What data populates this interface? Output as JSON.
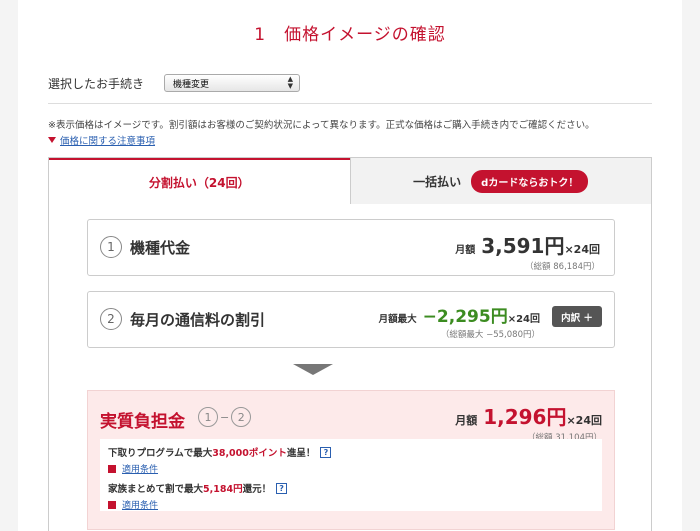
{
  "header": {
    "title": "1　価格イメージの確認"
  },
  "procedure": {
    "label": "選択したお手続き",
    "selected": "機種変更",
    "arrows_icon": "updown-arrows-icon"
  },
  "note": "※表示価格はイメージです。割引額はお客様のご契約状況によって異なります。正式な価格はご購入手続き内でご確認ください。",
  "notice_link": {
    "label": "価格に関する注意事項",
    "icon": "triangle-down-icon"
  },
  "tabs": [
    {
      "label": "分割払い（24回）",
      "active": true
    },
    {
      "label": "一括払い",
      "badge": "dカードならおトク！",
      "active": false
    }
  ],
  "items": [
    {
      "num": "1",
      "label": "機種代金",
      "prefix": "月額",
      "amount": "3,591円",
      "suffix": "×24回",
      "sub": "（総額 86,184円）"
    },
    {
      "num": "2",
      "label": "毎月の通信料の割引",
      "prefix": "月額最大",
      "amount": "−2,295円",
      "suffix": "×24回",
      "sub": "（総額最大 −55,080円）",
      "button": "内訳 ＋"
    }
  ],
  "total": {
    "label": "実質負担金",
    "formula": {
      "a": "1",
      "dash": "−",
      "b": "2"
    },
    "prefix": "月額",
    "amount": "1,296円",
    "suffix": "×24回",
    "sub": "（総額 31,104円）",
    "promos": [
      {
        "text_a": "下取りプログラムで最大",
        "highlight": "38,000ポイント",
        "text_b": "進呈！",
        "help": "?",
        "cond": "適用条件"
      },
      {
        "text_a": "家族まとめて割で最大",
        "highlight": "5,184円",
        "text_b": "還元！",
        "help": "?",
        "cond": "適用条件"
      }
    ]
  },
  "colors": {
    "accent": "#c4122f",
    "discount": "#3c8c21",
    "link": "#2a5fb0"
  }
}
